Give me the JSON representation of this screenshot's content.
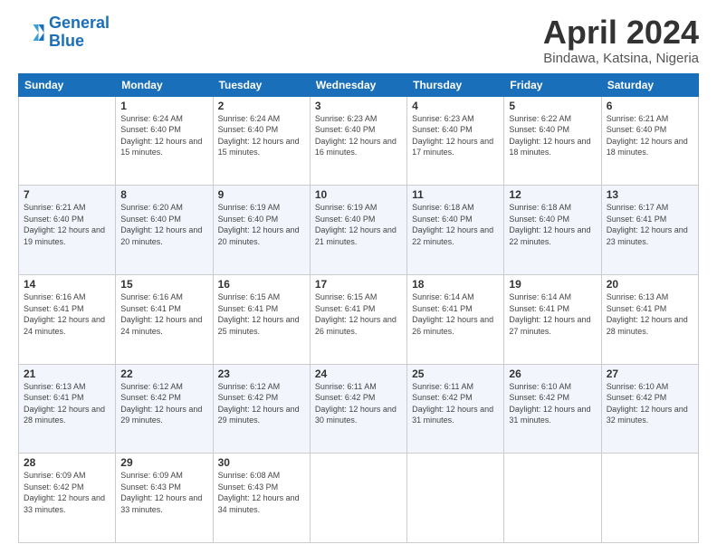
{
  "header": {
    "logo_line1": "General",
    "logo_line2": "Blue",
    "month": "April 2024",
    "location": "Bindawa, Katsina, Nigeria"
  },
  "weekdays": [
    "Sunday",
    "Monday",
    "Tuesday",
    "Wednesday",
    "Thursday",
    "Friday",
    "Saturday"
  ],
  "weeks": [
    [
      {
        "day": "",
        "sunrise": "",
        "sunset": "",
        "daylight": ""
      },
      {
        "day": "1",
        "sunrise": "Sunrise: 6:24 AM",
        "sunset": "Sunset: 6:40 PM",
        "daylight": "Daylight: 12 hours and 15 minutes."
      },
      {
        "day": "2",
        "sunrise": "Sunrise: 6:24 AM",
        "sunset": "Sunset: 6:40 PM",
        "daylight": "Daylight: 12 hours and 15 minutes."
      },
      {
        "day": "3",
        "sunrise": "Sunrise: 6:23 AM",
        "sunset": "Sunset: 6:40 PM",
        "daylight": "Daylight: 12 hours and 16 minutes."
      },
      {
        "day": "4",
        "sunrise": "Sunrise: 6:23 AM",
        "sunset": "Sunset: 6:40 PM",
        "daylight": "Daylight: 12 hours and 17 minutes."
      },
      {
        "day": "5",
        "sunrise": "Sunrise: 6:22 AM",
        "sunset": "Sunset: 6:40 PM",
        "daylight": "Daylight: 12 hours and 18 minutes."
      },
      {
        "day": "6",
        "sunrise": "Sunrise: 6:21 AM",
        "sunset": "Sunset: 6:40 PM",
        "daylight": "Daylight: 12 hours and 18 minutes."
      }
    ],
    [
      {
        "day": "7",
        "sunrise": "Sunrise: 6:21 AM",
        "sunset": "Sunset: 6:40 PM",
        "daylight": "Daylight: 12 hours and 19 minutes."
      },
      {
        "day": "8",
        "sunrise": "Sunrise: 6:20 AM",
        "sunset": "Sunset: 6:40 PM",
        "daylight": "Daylight: 12 hours and 20 minutes."
      },
      {
        "day": "9",
        "sunrise": "Sunrise: 6:19 AM",
        "sunset": "Sunset: 6:40 PM",
        "daylight": "Daylight: 12 hours and 20 minutes."
      },
      {
        "day": "10",
        "sunrise": "Sunrise: 6:19 AM",
        "sunset": "Sunset: 6:40 PM",
        "daylight": "Daylight: 12 hours and 21 minutes."
      },
      {
        "day": "11",
        "sunrise": "Sunrise: 6:18 AM",
        "sunset": "Sunset: 6:40 PM",
        "daylight": "Daylight: 12 hours and 22 minutes."
      },
      {
        "day": "12",
        "sunrise": "Sunrise: 6:18 AM",
        "sunset": "Sunset: 6:40 PM",
        "daylight": "Daylight: 12 hours and 22 minutes."
      },
      {
        "day": "13",
        "sunrise": "Sunrise: 6:17 AM",
        "sunset": "Sunset: 6:41 PM",
        "daylight": "Daylight: 12 hours and 23 minutes."
      }
    ],
    [
      {
        "day": "14",
        "sunrise": "Sunrise: 6:16 AM",
        "sunset": "Sunset: 6:41 PM",
        "daylight": "Daylight: 12 hours and 24 minutes."
      },
      {
        "day": "15",
        "sunrise": "Sunrise: 6:16 AM",
        "sunset": "Sunset: 6:41 PM",
        "daylight": "Daylight: 12 hours and 24 minutes."
      },
      {
        "day": "16",
        "sunrise": "Sunrise: 6:15 AM",
        "sunset": "Sunset: 6:41 PM",
        "daylight": "Daylight: 12 hours and 25 minutes."
      },
      {
        "day": "17",
        "sunrise": "Sunrise: 6:15 AM",
        "sunset": "Sunset: 6:41 PM",
        "daylight": "Daylight: 12 hours and 26 minutes."
      },
      {
        "day": "18",
        "sunrise": "Sunrise: 6:14 AM",
        "sunset": "Sunset: 6:41 PM",
        "daylight": "Daylight: 12 hours and 26 minutes."
      },
      {
        "day": "19",
        "sunrise": "Sunrise: 6:14 AM",
        "sunset": "Sunset: 6:41 PM",
        "daylight": "Daylight: 12 hours and 27 minutes."
      },
      {
        "day": "20",
        "sunrise": "Sunrise: 6:13 AM",
        "sunset": "Sunset: 6:41 PM",
        "daylight": "Daylight: 12 hours and 28 minutes."
      }
    ],
    [
      {
        "day": "21",
        "sunrise": "Sunrise: 6:13 AM",
        "sunset": "Sunset: 6:41 PM",
        "daylight": "Daylight: 12 hours and 28 minutes."
      },
      {
        "day": "22",
        "sunrise": "Sunrise: 6:12 AM",
        "sunset": "Sunset: 6:42 PM",
        "daylight": "Daylight: 12 hours and 29 minutes."
      },
      {
        "day": "23",
        "sunrise": "Sunrise: 6:12 AM",
        "sunset": "Sunset: 6:42 PM",
        "daylight": "Daylight: 12 hours and 29 minutes."
      },
      {
        "day": "24",
        "sunrise": "Sunrise: 6:11 AM",
        "sunset": "Sunset: 6:42 PM",
        "daylight": "Daylight: 12 hours and 30 minutes."
      },
      {
        "day": "25",
        "sunrise": "Sunrise: 6:11 AM",
        "sunset": "Sunset: 6:42 PM",
        "daylight": "Daylight: 12 hours and 31 minutes."
      },
      {
        "day": "26",
        "sunrise": "Sunrise: 6:10 AM",
        "sunset": "Sunset: 6:42 PM",
        "daylight": "Daylight: 12 hours and 31 minutes."
      },
      {
        "day": "27",
        "sunrise": "Sunrise: 6:10 AM",
        "sunset": "Sunset: 6:42 PM",
        "daylight": "Daylight: 12 hours and 32 minutes."
      }
    ],
    [
      {
        "day": "28",
        "sunrise": "Sunrise: 6:09 AM",
        "sunset": "Sunset: 6:42 PM",
        "daylight": "Daylight: 12 hours and 33 minutes."
      },
      {
        "day": "29",
        "sunrise": "Sunrise: 6:09 AM",
        "sunset": "Sunset: 6:43 PM",
        "daylight": "Daylight: 12 hours and 33 minutes."
      },
      {
        "day": "30",
        "sunrise": "Sunrise: 6:08 AM",
        "sunset": "Sunset: 6:43 PM",
        "daylight": "Daylight: 12 hours and 34 minutes."
      },
      {
        "day": "",
        "sunrise": "",
        "sunset": "",
        "daylight": ""
      },
      {
        "day": "",
        "sunrise": "",
        "sunset": "",
        "daylight": ""
      },
      {
        "day": "",
        "sunrise": "",
        "sunset": "",
        "daylight": ""
      },
      {
        "day": "",
        "sunrise": "",
        "sunset": "",
        "daylight": ""
      }
    ]
  ]
}
